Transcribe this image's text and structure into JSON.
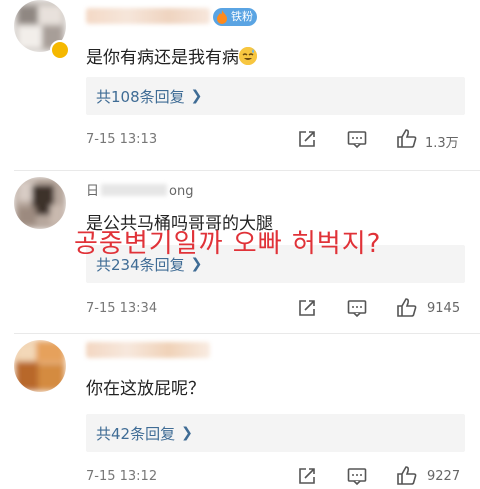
{
  "comments": [
    {
      "badge": "铁粉",
      "text": "是你有病还是我有病",
      "emoji_icon": "grinning-sweat-emoji-icon",
      "reply_label": "共108条回复",
      "time": "7-15 13:13",
      "likes": "1.3万"
    },
    {
      "name_partial_left": "日",
      "name_partial_right": "ong",
      "text": "是公共马桶吗哥哥的大腿",
      "reply_label": "共234条回复",
      "time": "7-15 13:34",
      "likes": "9145"
    },
    {
      "text": "你在这放屁呢？",
      "reply_label": "共42条回复",
      "time": "7-15 13:12",
      "likes": "9227"
    }
  ],
  "overlay_caption": "공중변기일까 오빠 허벅지?",
  "icons": {
    "share": "share-icon",
    "comment": "comment-icon",
    "like": "thumbs-up-icon",
    "chevron": "chevron-right-icon"
  },
  "colors": {
    "reply_link": "#3f6c95",
    "overlay_text": "#e03238",
    "badge": "#5aa4e3",
    "reply_bg": "#f4f4f4"
  }
}
